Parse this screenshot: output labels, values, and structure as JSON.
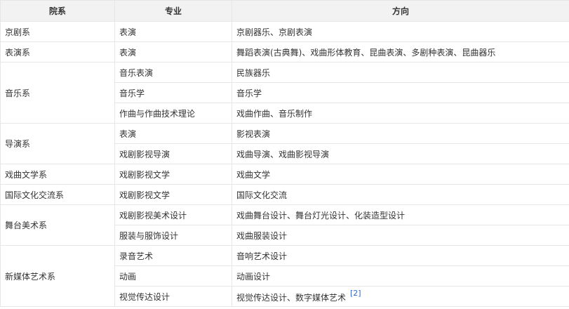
{
  "table": {
    "headers": [
      "院系",
      "专业",
      "方向"
    ],
    "groups": [
      {
        "dept": "京剧系",
        "rows": [
          {
            "major": "表演",
            "direction": "京剧器乐、京剧表演"
          }
        ]
      },
      {
        "dept": "表演系",
        "rows": [
          {
            "major": "表演",
            "direction": "舞蹈表演(古典舞)、戏曲形体教育、昆曲表演、多剧种表演、昆曲器乐"
          }
        ]
      },
      {
        "dept": "音乐系",
        "rows": [
          {
            "major": "音乐表演",
            "direction": "民族器乐"
          },
          {
            "major": "音乐学",
            "direction": "音乐学"
          },
          {
            "major": "作曲与作曲技术理论",
            "direction": "戏曲作曲、音乐制作"
          }
        ]
      },
      {
        "dept": "导演系",
        "rows": [
          {
            "major": "表演",
            "direction": "影视表演"
          },
          {
            "major": "戏剧影视导演",
            "direction": "戏曲导演、戏曲影视导演"
          }
        ]
      },
      {
        "dept": "戏曲文学系",
        "rows": [
          {
            "major": "戏剧影视文学",
            "direction": "戏曲文学"
          }
        ]
      },
      {
        "dept": "国际文化交流系",
        "rows": [
          {
            "major": "戏剧影视文学",
            "direction": "国际文化交流"
          }
        ]
      },
      {
        "dept": "舞台美术系",
        "rows": [
          {
            "major": "戏剧影视美术设计",
            "direction": "戏曲舞台设计、舞台灯光设计、化装造型设计"
          },
          {
            "major": "服装与服饰设计",
            "direction": "戏曲服装设计"
          }
        ]
      },
      {
        "dept": "新媒体艺术系",
        "rows": [
          {
            "major": "录音艺术",
            "direction": "音响艺术设计"
          },
          {
            "major": "动画",
            "direction": "动画设计"
          },
          {
            "major": "视觉传达设计",
            "direction": "视觉传达设计、数字媒体艺术",
            "ref": "[2]"
          }
        ]
      }
    ]
  }
}
